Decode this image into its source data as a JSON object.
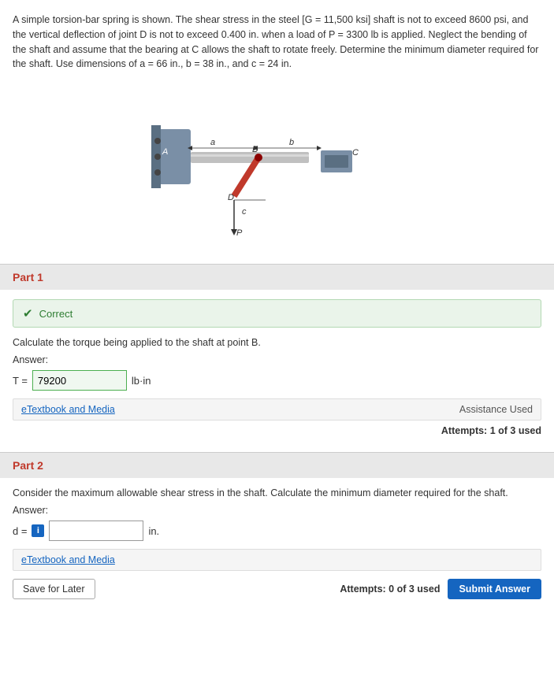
{
  "problem": {
    "statement": "A simple torsion-bar spring is shown. The shear stress in the steel [G = 11,500 ksi] shaft is not to exceed 8600 psi, and the vertical deflection of joint D is not to exceed 0.400 in. when a load of P = 3300 lb is applied. Neglect the bending of the shaft and assume that the bearing at C allows the shaft to rotate freely. Determine the minimum diameter required for the shaft. Use dimensions of a = 66 in., b = 38 in., and c = 24 in."
  },
  "part1": {
    "header": "Part 1",
    "status": "Correct",
    "question": "Calculate the torque being applied to the shaft at point B.",
    "answer_label": "Answer:",
    "prefix": "T =",
    "input_value": "79200",
    "unit": "lb·in",
    "resource_label": "eTextbook and Media",
    "assistance_used": "Assistance Used",
    "attempts": "Attempts: 1 of 3 used"
  },
  "part2": {
    "header": "Part 2",
    "question": "Consider the maximum allowable shear stress in the shaft. Calculate the minimum diameter required for the shaft.",
    "answer_label": "Answer:",
    "prefix": "d =",
    "input_value": "",
    "unit": "in.",
    "resource_label": "eTextbook and Media",
    "save_label": "Save for Later",
    "attempts": "Attempts: 0 of 3 used",
    "submit_label": "Submit Answer"
  },
  "icons": {
    "check": "✔",
    "info": "i"
  }
}
